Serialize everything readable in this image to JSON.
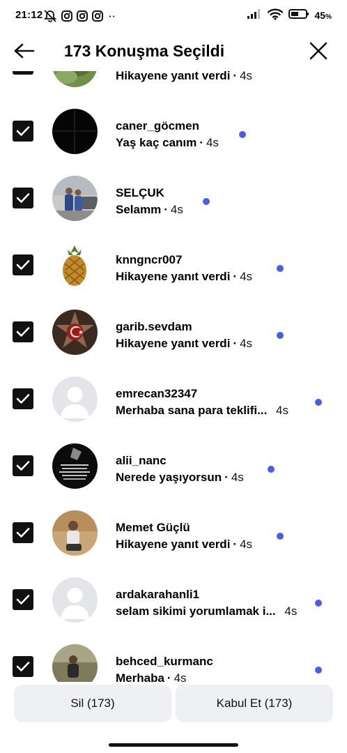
{
  "status_bar": {
    "time": "21:12",
    "dots": "··",
    "battery": "45",
    "battery_unit": "%"
  },
  "header": {
    "title": "173 Konuşma Seçildi"
  },
  "conversations": [
    {
      "name": "",
      "message": "Hikayene yanıt verdi",
      "time": "4s",
      "selected": true
    },
    {
      "name": "caner_göcmen",
      "message": "Yaş kaç canım",
      "time": "4s",
      "selected": true,
      "unread": true
    },
    {
      "name": "SELÇUK",
      "message": "Selamm",
      "time": "4s",
      "selected": true,
      "unread": true
    },
    {
      "name": "knngncr007",
      "message": "Hikayene yanıt verdi",
      "time": "4s",
      "selected": true,
      "unread": true
    },
    {
      "name": "garib.sevdam",
      "message": "Hikayene yanıt verdi",
      "time": "4s",
      "selected": true,
      "unread": true
    },
    {
      "name": "emrecan32347",
      "message": "Merhaba sana para teklifi...",
      "time": "4s",
      "selected": true,
      "unread": true
    },
    {
      "name": "alii_nanc",
      "message": "Nerede yaşıyorsun",
      "time": "4s",
      "selected": true,
      "unread": true
    },
    {
      "name": "Memet Güçlü",
      "message": "Hikayene yanıt verdi",
      "time": "4s",
      "selected": true,
      "unread": true
    },
    {
      "name": "ardakarahanli1",
      "message": "selam sikimi yorumlamak i...",
      "time": "4s",
      "selected": true,
      "unread": true
    },
    {
      "name": "behced_kurmanc",
      "message": "Merhaba",
      "time": "4s",
      "selected": true,
      "unread": true
    }
  ],
  "actions": {
    "delete_label": "Sil (173)",
    "accept_label": "Kabul Et (173)"
  },
  "colors": {
    "unread_dot": "#4a5cf0",
    "button_bg": "#eff0f3",
    "checkbox": "#111111"
  }
}
